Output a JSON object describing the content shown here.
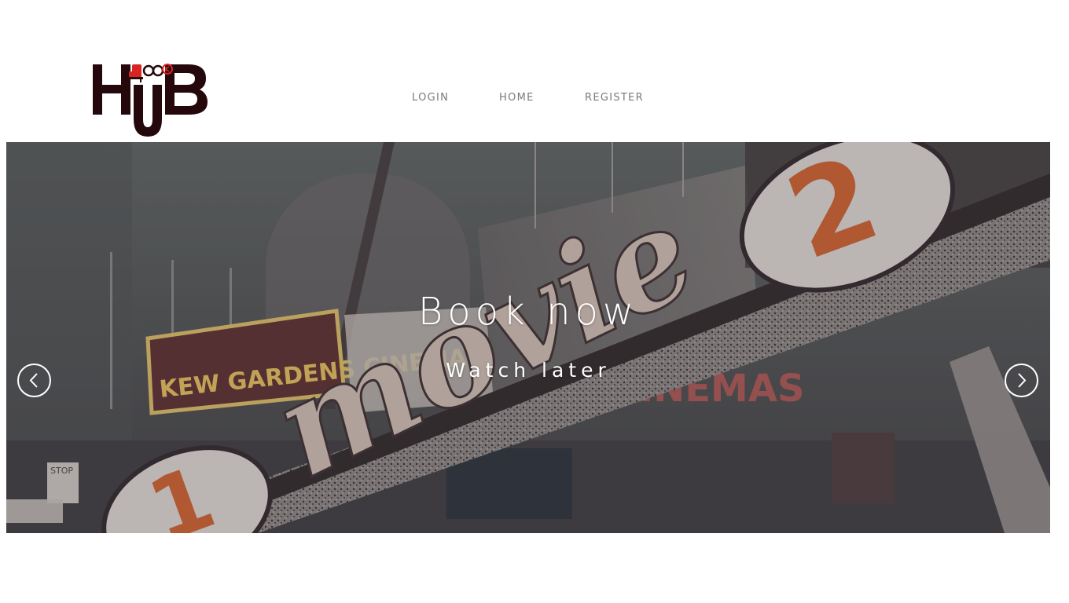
{
  "logo": {
    "alt": "BookHub logo",
    "top_text": "BOOK",
    "main_text": "HUB",
    "colors": {
      "dark": "#24080c",
      "accent": "#d92424"
    }
  },
  "nav": {
    "items": [
      {
        "label": "LOGIN"
      },
      {
        "label": "HOME"
      },
      {
        "label": "REGISTER"
      }
    ]
  },
  "hero": {
    "title": "Book now",
    "subtitle": "Watch later",
    "background_icon": "cinema-marquee-photo",
    "prev_icon": "chevron-left-icon",
    "next_icon": "chevron-right-icon"
  },
  "colors": {
    "nav_text": "#7a7a7a",
    "hero_text": "#ffffff",
    "marquee_orange": "#d8622a"
  }
}
